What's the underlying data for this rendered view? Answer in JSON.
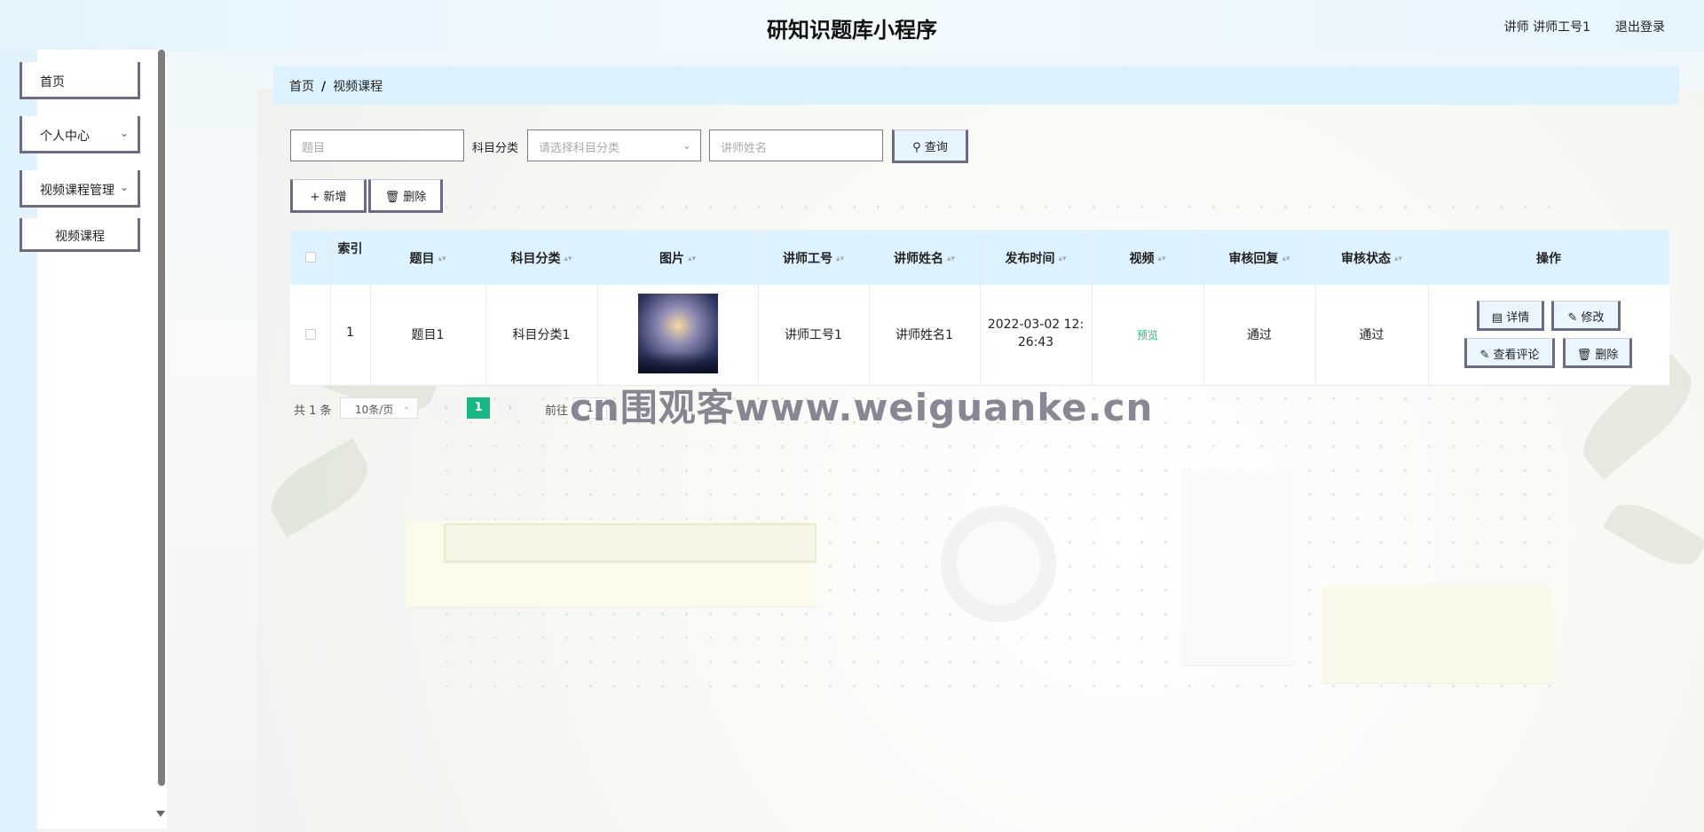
{
  "header": {
    "title": "研知识题库小程序",
    "user": "讲师 讲师工号1",
    "logout": "退出登录"
  },
  "sidebar": {
    "items": [
      {
        "label": "首页"
      },
      {
        "label": "个人中心"
      },
      {
        "label": "视频课程管理"
      }
    ],
    "sub_item": "视频课程"
  },
  "breadcrumb": {
    "home": "首页",
    "sep": "/",
    "current": "视频课程"
  },
  "search": {
    "title_placeholder": "题目",
    "category_label": "科目分类",
    "category_placeholder": "请选择科目分类",
    "teacher_placeholder": "讲师姓名",
    "query_button": "查询"
  },
  "actions": {
    "add": "新增",
    "delete": "删除"
  },
  "table": {
    "headers": [
      "索引",
      "题目",
      "科目分类",
      "图片",
      "讲师工号",
      "讲师姓名",
      "发布时间",
      "视频",
      "审核回复",
      "审核状态",
      "操作"
    ],
    "row": {
      "index": "1",
      "title": "题目1",
      "category": "科目分类1",
      "teacher_no": "讲师工号1",
      "teacher_name": "讲师姓名1",
      "publish_time_line1": "2022-03-02 12:",
      "publish_time_line2": "26:43",
      "video": "预览",
      "review_reply": "通过",
      "review_status": "通过",
      "ops": {
        "detail": "详情",
        "edit": "修改",
        "comments": "查看评论",
        "delete": "删除"
      }
    }
  },
  "pagination": {
    "total": "共 1 条",
    "page_size": "10条/页",
    "current_page": "1",
    "goto_label": "前往",
    "goto_value": "1"
  },
  "watermark": "cn围观客www.weiguanke.cn",
  "colors": {
    "accent": "#16b986",
    "header_bg": "#dcf2fe",
    "button_border": "#6b6b86"
  }
}
